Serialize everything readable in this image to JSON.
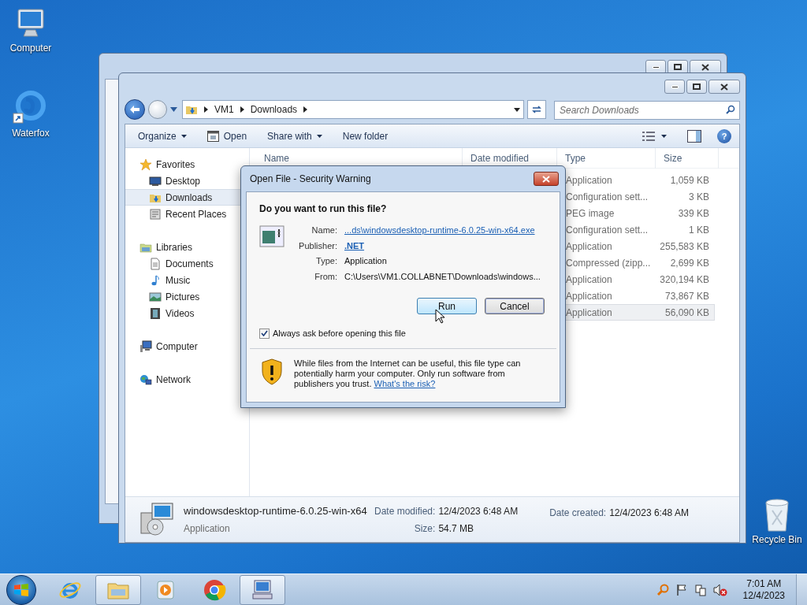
{
  "desktop_icons": [
    {
      "label": "Computer",
      "kind": "computer"
    },
    {
      "label": "Waterfox",
      "kind": "waterfox"
    },
    {
      "label": "Recycle Bin",
      "kind": "recycle"
    }
  ],
  "explorer": {
    "breadcrumb": [
      "VM1",
      "Downloads"
    ],
    "search": {
      "placeholder": "Search Downloads"
    },
    "toolbar": [
      {
        "label": "Organize",
        "kind": "menu"
      },
      {
        "label": "Open",
        "kind": "open"
      },
      {
        "label": "Share with",
        "kind": "menu"
      },
      {
        "label": "New folder",
        "kind": "plain"
      }
    ],
    "help_button": "?",
    "nav": [
      {
        "label": "Favorites",
        "kind": "star",
        "selected": false,
        "children": [
          {
            "label": "Desktop",
            "kind": "desktop",
            "selected": false
          },
          {
            "label": "Downloads",
            "kind": "downloads",
            "selected": true
          },
          {
            "label": "Recent Places",
            "kind": "recent",
            "selected": false
          }
        ]
      },
      {
        "label": "Libraries",
        "kind": "library",
        "selected": false,
        "children": [
          {
            "label": "Documents",
            "kind": "document",
            "selected": false
          },
          {
            "label": "Music",
            "kind": "music",
            "selected": false
          },
          {
            "label": "Pictures",
            "kind": "picture",
            "selected": false
          },
          {
            "label": "Videos",
            "kind": "video",
            "selected": false
          }
        ]
      },
      {
        "label": "Computer",
        "kind": "computer",
        "selected": false
      },
      {
        "label": "Network",
        "kind": "network",
        "selected": false
      }
    ],
    "columns": [
      "Name",
      "Date modified",
      "Type",
      "Size"
    ],
    "rows": [
      {
        "type": "Application",
        "size": "1,059 KB",
        "selected": false
      },
      {
        "type": "Configuration sett...",
        "size": "3 KB",
        "selected": false
      },
      {
        "type": "PEG image",
        "size": "339 KB",
        "selected": false
      },
      {
        "type": "Configuration sett...",
        "size": "1 KB",
        "selected": false
      },
      {
        "type": "Application",
        "size": "255,583 KB",
        "selected": false
      },
      {
        "type": "Compressed (zipp...",
        "size": "2,699 KB",
        "selected": false
      },
      {
        "type": "Application",
        "size": "320,194 KB",
        "selected": false
      },
      {
        "type": "Application",
        "size": "73,867 KB",
        "selected": false
      },
      {
        "type": "Application",
        "size": "56,090 KB",
        "selected": true
      }
    ],
    "details": {
      "name": "windowsdesktop-runtime-6.0.25-win-x64",
      "type": "Application",
      "fields": [
        {
          "label": "Date modified:",
          "value": "12/4/2023 6:48 AM"
        },
        {
          "label": "Size:",
          "value": "54.7 MB"
        },
        {
          "label": "Date created:",
          "value": "12/4/2023 6:48 AM"
        }
      ]
    }
  },
  "dialog": {
    "title": "Open File - Security Warning",
    "question": "Do you want to run this file?",
    "fields": [
      {
        "label": "Name:",
        "value": "...ds\\windowsdesktop-runtime-6.0.25-win-x64.exe",
        "kind": "link"
      },
      {
        "label": "Publisher:",
        "value": ".NET",
        "kind": "bold_link"
      },
      {
        "label": "Type:",
        "value": "Application",
        "kind": "text"
      },
      {
        "label": "From:",
        "value": "C:\\Users\\VM1.COLLABNET\\Downloads\\windows...",
        "kind": "text"
      }
    ],
    "buttons": [
      {
        "label": "Run",
        "highlighted": true
      },
      {
        "label": "Cancel",
        "highlighted": false
      }
    ],
    "checkbox": {
      "label": "Always ask before opening this file",
      "checked": true
    },
    "warning": {
      "text": "While files from the Internet can be useful, this file type can potentially harm your computer. Only run software from publishers you trust.",
      "link": "What's the risk?"
    }
  },
  "taskbar": {
    "apps": [
      {
        "kind": "ie",
        "active": false
      },
      {
        "kind": "explorer",
        "active": true
      },
      {
        "kind": "media",
        "active": false
      },
      {
        "kind": "chrome",
        "active": false
      },
      {
        "kind": "dialog",
        "active": true
      }
    ],
    "time": "7:01 AM",
    "date": "12/4/2023"
  }
}
